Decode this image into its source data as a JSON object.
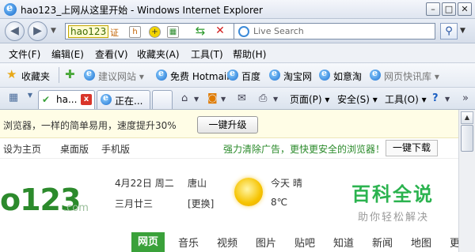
{
  "window": {
    "title": "hao123_上网从这里开始 - Windows Internet Explorer",
    "minimize": "–",
    "restore": "□",
    "close": "✕"
  },
  "address": {
    "url": "hao123",
    "badge": "证",
    "search_placeholder": "Live Search"
  },
  "menu": {
    "file": "文件(F)",
    "edit": "编辑(E)",
    "view": "查看(V)",
    "favorites": "收藏夹(A)",
    "tools": "工具(T)",
    "help": "帮助(H)"
  },
  "favorites_bar": {
    "label": "收藏夹",
    "items": [
      "建议网站 ▾",
      "免费 Hotmail",
      "百度",
      "淘宝网",
      "如意淘",
      "网页快讯库 ▾"
    ]
  },
  "tabs": {
    "items": [
      {
        "label": "ha..."
      },
      {
        "label": "正在..."
      }
    ],
    "tools": {
      "page": "页面(P) ▾",
      "safety": "安全(S) ▾",
      "tools": "工具(O) ▾"
    }
  },
  "page": {
    "notice": {
      "text": "浏览器，一样的简单易用，速度提升30%",
      "button": "一键升级"
    },
    "nav": {
      "set_home": "设为主页",
      "desktop": "桌面版",
      "mobile": "手机版",
      "ad": "强力清除广告，更快更安全的浏览器！",
      "download": "一键下载"
    },
    "logo": {
      "text": "o123",
      "suffix": ".com"
    },
    "date": {
      "solar": "4月22日 周二",
      "lunar": "三月廿三"
    },
    "location": {
      "city": "唐山",
      "change": "[更换]"
    },
    "weather": {
      "today": "今天 晴",
      "temp": "8℃"
    },
    "categories": [
      "网页",
      "音乐",
      "视频",
      "图片",
      "贴吧",
      "知道",
      "新闻",
      "地图",
      "更"
    ]
  },
  "watermark": {
    "title": "百科全说",
    "subtitle": "助你轻松解决"
  },
  "colors": {
    "accent_green": "#3aa13a",
    "ie_blue": "#1b6fd0"
  }
}
